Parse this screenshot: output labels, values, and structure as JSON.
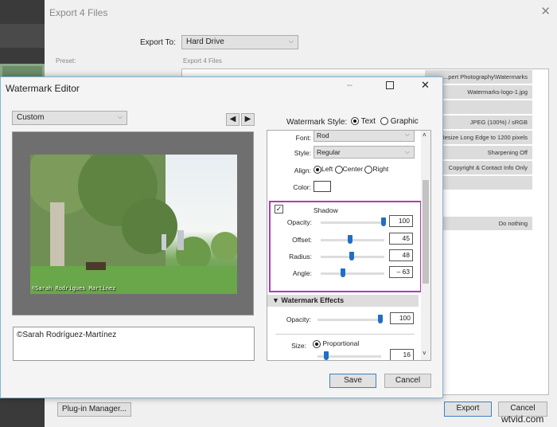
{
  "export_dialog": {
    "title": "Export 4 Files",
    "export_to_label": "Export To:",
    "export_to_value": "Hard Drive",
    "preset_label": "Preset:",
    "list_header": "Export 4 Files",
    "rows": [
      "...pert Photography\\Watermarks",
      "Watermarks-logo-1.jpg",
      "JPEG (100%) / sRGB",
      "Resize Long Edge to 1200 pixels",
      "Sharpening Off",
      "Copyright & Contact Info Only",
      "Do nothing"
    ],
    "plugin_manager": "Plug-in Manager...",
    "export_button": "Export",
    "cancel_button": "Cancel"
  },
  "watermark_editor": {
    "title": "Watermark Editor",
    "preset_value": "Custom",
    "watermark_style_label": "Watermark Style:",
    "style_text": "Text",
    "style_graphic": "Graphic",
    "selected_style": "Text",
    "preview_watermark": "©Sarah Rodrigues Martinez",
    "text_value": "©Sarah Rodríguez-Martínez",
    "font_label": "Font:",
    "font_value": "Rod",
    "style_label": "Style:",
    "style_value": "Regular",
    "align_label": "Align:",
    "align_left": "Left",
    "align_center": "Center",
    "align_right": "Right",
    "align_selected": "Left",
    "color_label": "Color:",
    "shadow": {
      "label": "Shadow",
      "checked": true,
      "opacity_label": "Opacity:",
      "opacity": 100,
      "offset_label": "Offset:",
      "offset": 45,
      "radius_label": "Radius:",
      "radius": 48,
      "angle_label": "Angle:",
      "angle": "– 63"
    },
    "effects_header": "Watermark Effects",
    "effects_opacity_label": "Opacity:",
    "effects_opacity": 100,
    "size_label": "Size:",
    "size_mode": "Proportional",
    "size_value": 16,
    "save_button": "Save",
    "cancel_button": "Cancel",
    "highlight_color": "#b13bb8"
  },
  "watermark_site": "wtvid.com"
}
